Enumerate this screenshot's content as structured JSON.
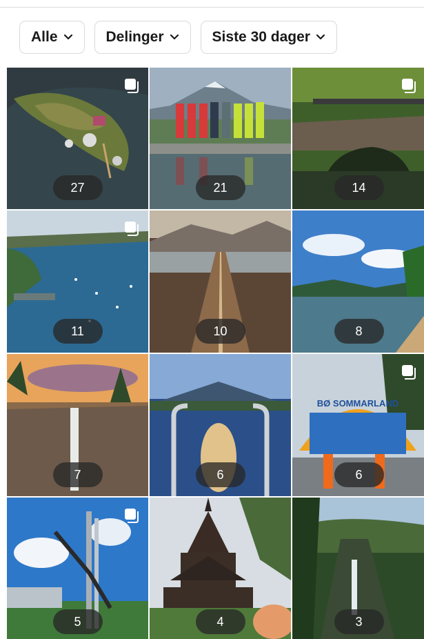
{
  "filters": [
    {
      "label": "Alle"
    },
    {
      "label": "Delinger"
    },
    {
      "label": "Siste 30 dager"
    }
  ],
  "posts": [
    {
      "count": "27",
      "multi": true,
      "icon": "multi-photo-icon",
      "sign": ""
    },
    {
      "count": "21",
      "multi": false,
      "icon": "",
      "sign": ""
    },
    {
      "count": "14",
      "multi": true,
      "icon": "multi-photo-icon",
      "sign": ""
    },
    {
      "count": "11",
      "multi": true,
      "icon": "multi-photo-icon",
      "sign": ""
    },
    {
      "count": "10",
      "multi": false,
      "icon": "",
      "sign": ""
    },
    {
      "count": "8",
      "multi": false,
      "icon": "",
      "sign": ""
    },
    {
      "count": "7",
      "multi": false,
      "icon": "",
      "sign": ""
    },
    {
      "count": "6",
      "multi": false,
      "icon": "",
      "sign": ""
    },
    {
      "count": "6",
      "multi": true,
      "icon": "multi-photo-icon",
      "sign": "BØ SOMMARLAND"
    },
    {
      "count": "5",
      "multi": true,
      "icon": "multi-photo-icon",
      "sign": ""
    },
    {
      "count": "4",
      "multi": false,
      "icon": "",
      "sign": ""
    },
    {
      "count": "3",
      "multi": false,
      "icon": "",
      "sign": ""
    }
  ]
}
